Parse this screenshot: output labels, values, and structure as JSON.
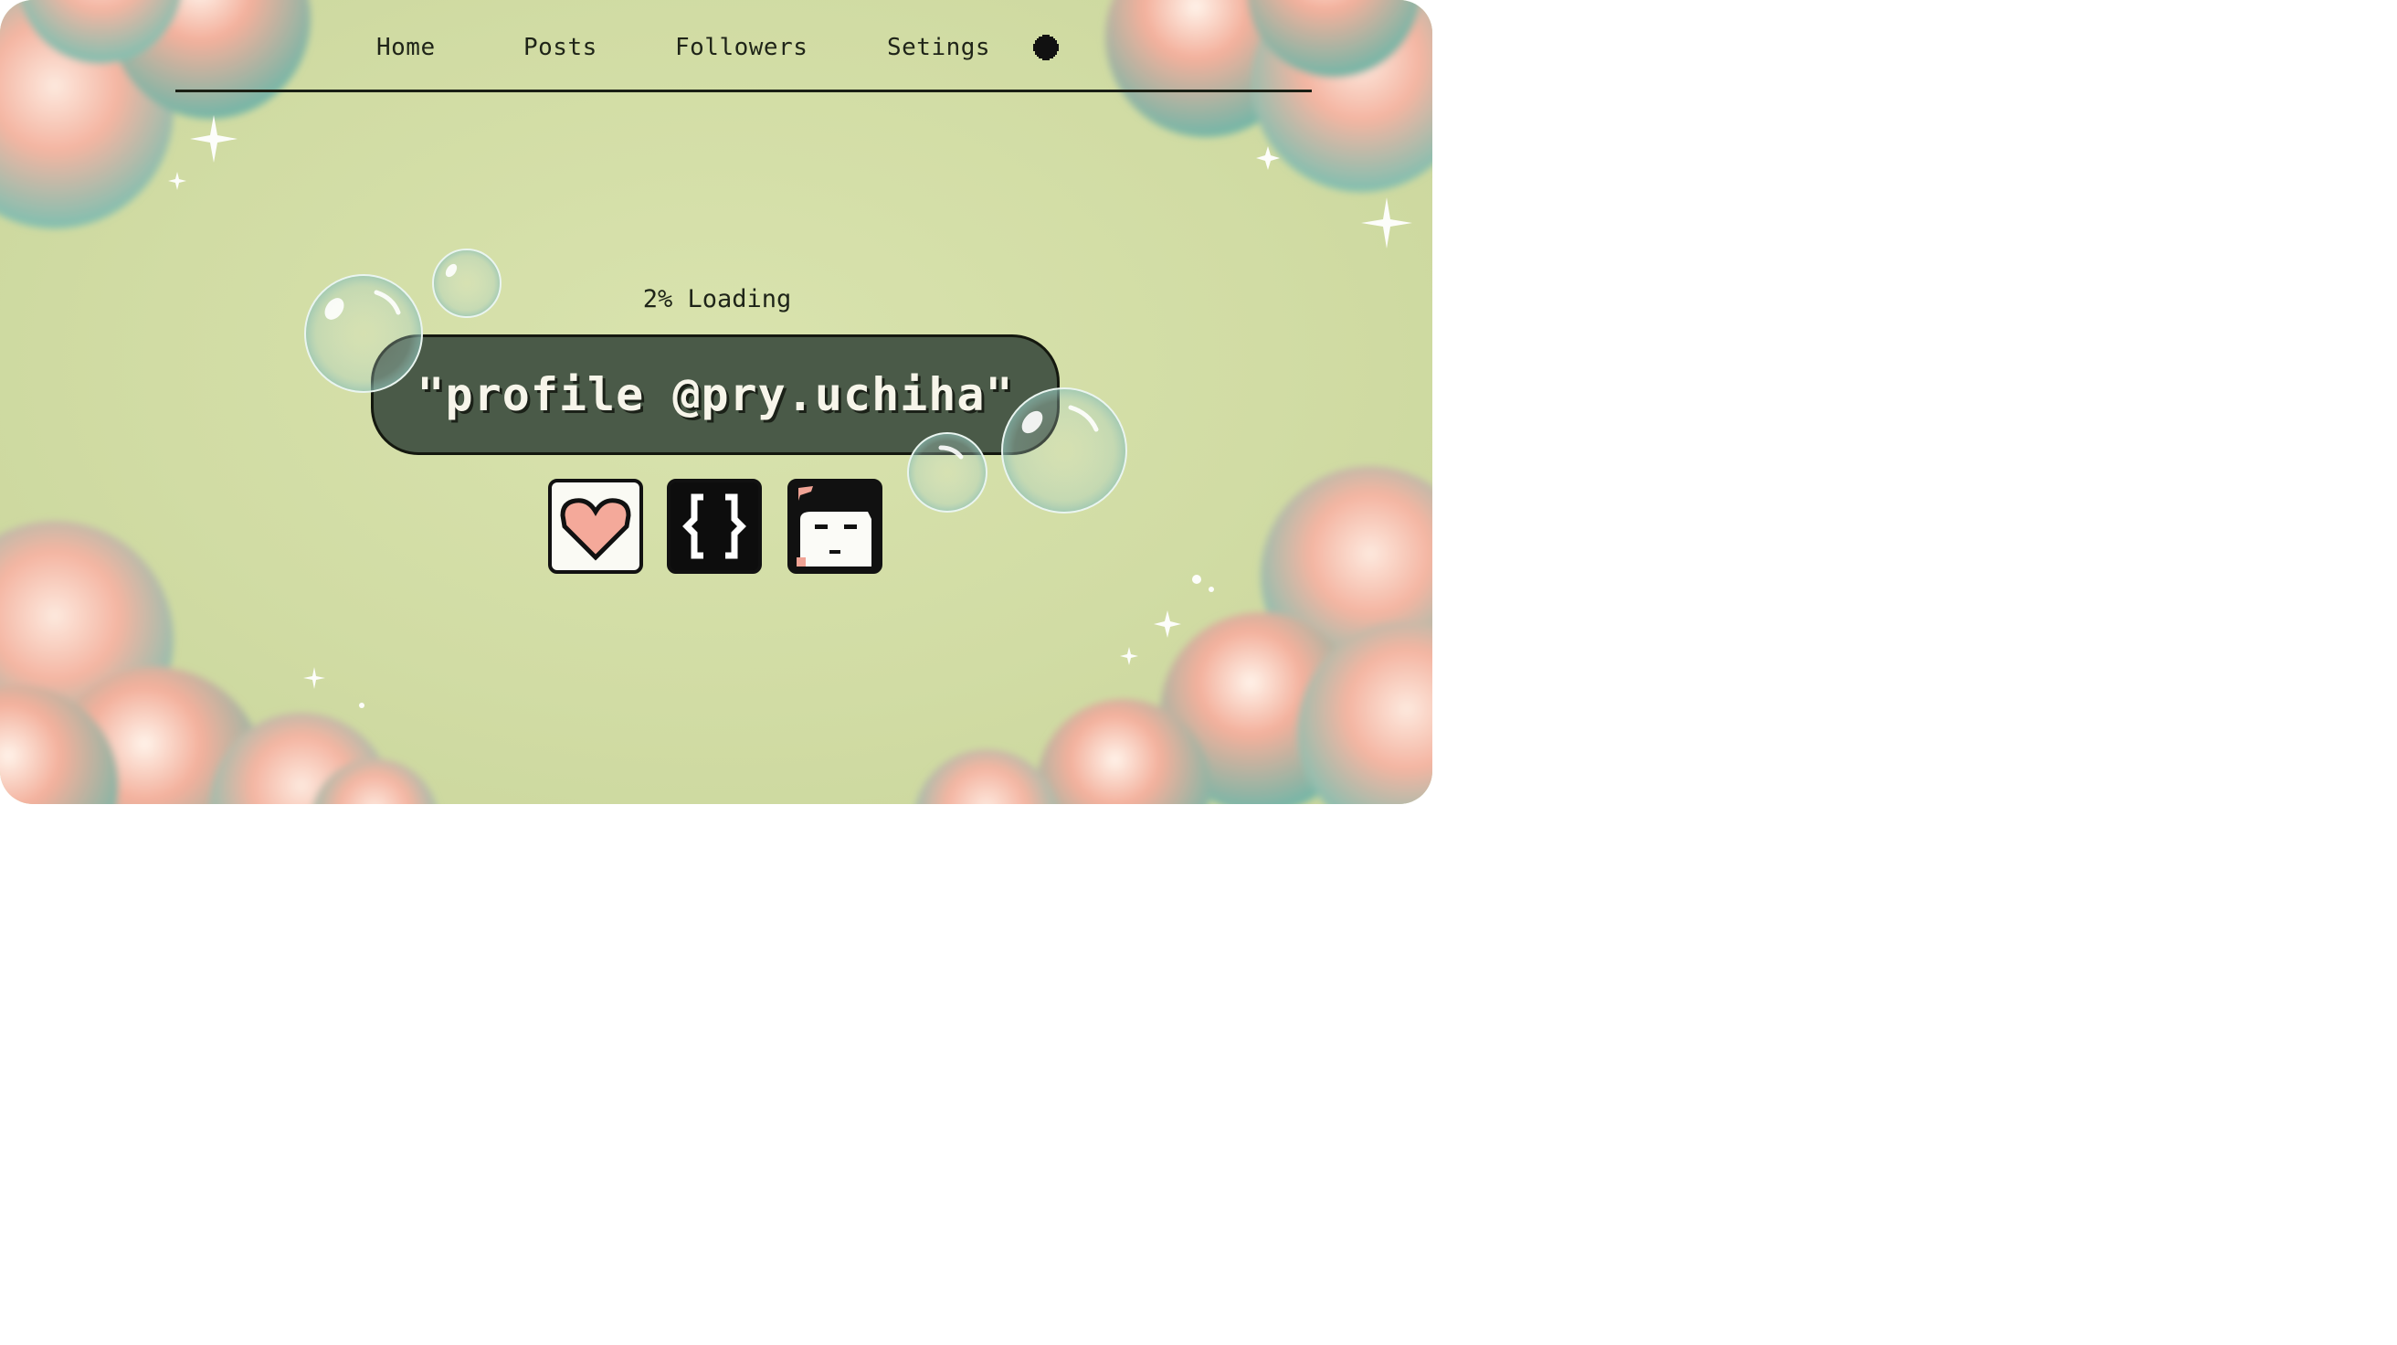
{
  "nav": {
    "items": [
      {
        "label": "Home"
      },
      {
        "label": "Posts"
      },
      {
        "label": "Followers"
      },
      {
        "label": "Setings"
      }
    ],
    "settings_icon": "gear-icon"
  },
  "loader": {
    "progress_percent": 2,
    "status_text": "2% Loading",
    "command_text": "\"profile @pry.uchiha\""
  },
  "icons": [
    {
      "name": "heart-icon"
    },
    {
      "name": "code-braces-icon"
    },
    {
      "name": "avatar-icon"
    }
  ],
  "colors": {
    "background": "#d1dca4",
    "pill": "#4a5a48",
    "heart": "#f4a99a",
    "cloud_teal": "#7fbfb0",
    "cloud_peach": "#f2b3a0"
  }
}
